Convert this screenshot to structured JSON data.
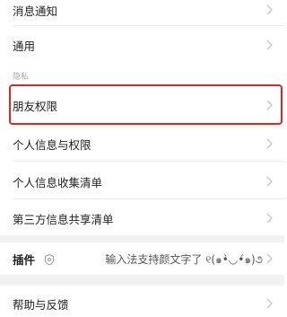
{
  "settings": {
    "messages_label": "消息通知",
    "general_label": "通用",
    "privacy_header": "隐私",
    "friend_permissions_label": "朋友权限",
    "personal_info_label": "个人信息与权限",
    "info_collection_label": "个人信息收集清单",
    "third_party_label": "第三方信息共享清单",
    "plugins_label": "插件",
    "plugins_value": "输入法支持颜文字了 ୧(๑•̀◡•́๑)૭",
    "help_label": "帮助与反馈"
  },
  "icons": {
    "chevron": "chevron-right-icon",
    "plugin": "plugin-icon"
  },
  "colors": {
    "highlight": "#d42a2a",
    "chevron": "#c4c4c4",
    "section_gap": "#f2f2f2"
  }
}
